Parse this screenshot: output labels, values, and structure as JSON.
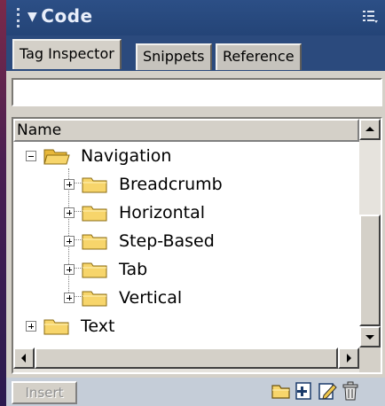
{
  "panel": {
    "title": "Code",
    "collapse_icon": "triangle-down-icon",
    "options_icon": "panel-options-icon"
  },
  "tabs": [
    {
      "label": "Tag Inspector",
      "active": true
    },
    {
      "label": "Snippets",
      "active": false
    },
    {
      "label": "Reference",
      "active": false
    }
  ],
  "tree": {
    "column_header": "Name",
    "items": [
      {
        "label": "Navigation",
        "expanded": true,
        "level": 0
      },
      {
        "label": "Breadcrumb",
        "expanded": false,
        "level": 1
      },
      {
        "label": "Horizontal",
        "expanded": false,
        "level": 1
      },
      {
        "label": "Step-Based",
        "expanded": false,
        "level": 1
      },
      {
        "label": "Tab",
        "expanded": false,
        "level": 1
      },
      {
        "label": "Vertical",
        "expanded": false,
        "level": 1
      },
      {
        "label": "Text",
        "expanded": false,
        "level": 0
      }
    ]
  },
  "footer": {
    "insert_label": "Insert",
    "icons": [
      "new-folder-icon",
      "new-snippet-icon",
      "edit-snippet-icon",
      "delete-icon"
    ]
  },
  "colors": {
    "header": "#2c4f86",
    "panel": "#d4d0c8",
    "folder": "#f7d56b"
  }
}
